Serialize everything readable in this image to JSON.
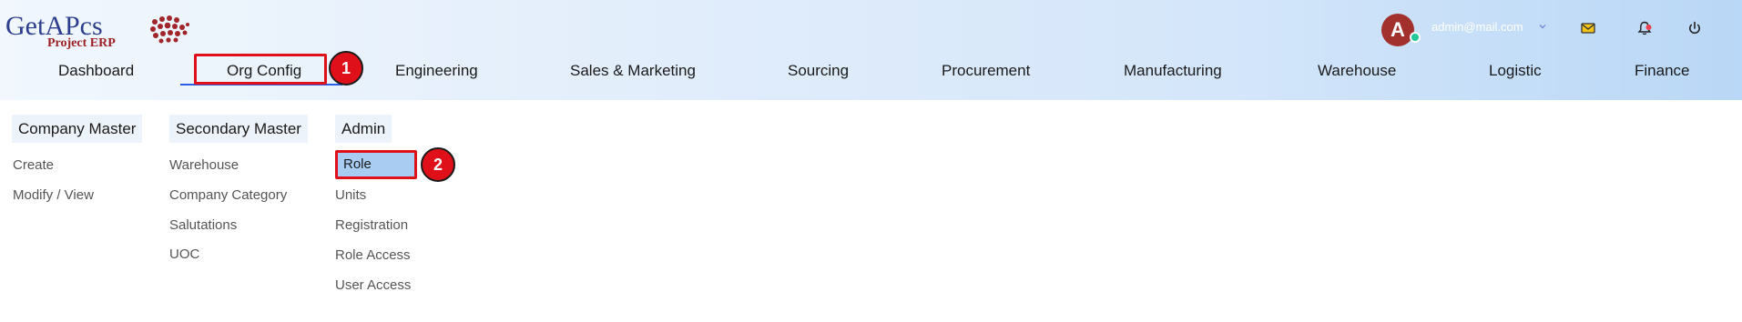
{
  "brand": {
    "logo_text": "GetAPcs",
    "logo_subtext": "Project ERP"
  },
  "user": {
    "avatar_letter": "A",
    "email": "admin@mail.com",
    "online_color": "#20c997",
    "avatar_color": "#a2302c"
  },
  "top_icons": [
    "mail-icon",
    "bell-icon",
    "power-icon"
  ],
  "nav": {
    "items": [
      {
        "label": "Dashboard"
      },
      {
        "label": "Org Config"
      },
      {
        "label": "Engineering"
      },
      {
        "label": "Sales & Marketing"
      },
      {
        "label": "Sourcing"
      },
      {
        "label": "Procurement"
      },
      {
        "label": "Manufacturing"
      },
      {
        "label": "Warehouse"
      },
      {
        "label": "Logistic"
      },
      {
        "label": "Finance"
      }
    ],
    "active": "Org Config"
  },
  "dropdown": {
    "columns": [
      {
        "header": "Company Master",
        "items": [
          "Create",
          "Modify / View"
        ]
      },
      {
        "header": "Secondary Master",
        "items": [
          "Warehouse",
          "Company Category",
          "Salutations",
          "UOC"
        ]
      },
      {
        "header": "Admin",
        "items": [
          "Role",
          "Units",
          "Registration",
          "Role Access",
          "User Access"
        ]
      }
    ],
    "selected_item": "Role"
  },
  "annotations": {
    "step1": "1",
    "step2": "2",
    "color": "#e0101a"
  }
}
